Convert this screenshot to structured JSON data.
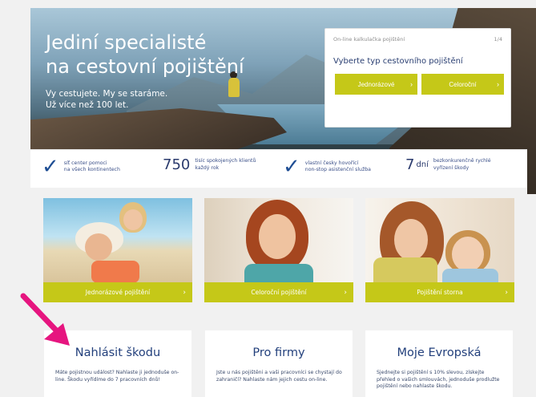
{
  "hero": {
    "title_line1": "Jediní specialisté",
    "title_line2": "na cestovní pojištění",
    "sub_line1": "Vy cestujete. My se staráme.",
    "sub_line2": "Už více než 100 let."
  },
  "quote": {
    "header_left": "On-line kalkulačka pojištění",
    "header_right": "1/4",
    "question": "Vyberte typ cestovního pojištění",
    "options": [
      "Jednorázové",
      "Celoroční"
    ]
  },
  "stats": [
    {
      "icon": "check-icon",
      "text_line1": "síť center pomoci",
      "text_line2": "na všech kontinentech"
    },
    {
      "number": "750",
      "text_line1": "tisíc spokojených klientů",
      "text_line2": "každý rok"
    },
    {
      "icon": "check-icon",
      "text_line1": "vlastní česky hovořící",
      "text_line2": "non-stop asistenční služba"
    },
    {
      "number": "7",
      "unit": "dní",
      "text_line1": "bezkonkurenčně rychlé",
      "text_line2": "vyřízení škody"
    }
  ],
  "products": [
    {
      "label": "Jednorázové pojištění"
    },
    {
      "label": "Celoroční pojištění"
    },
    {
      "label": "Pojištění storna"
    }
  ],
  "info_cards": [
    {
      "title": "Nahlásit škodu",
      "text": "Máte pojistnou událost? Nahlaste ji jednoduše on-line. Škodu vyřídíme do 7 pracovních dnů!"
    },
    {
      "title": "Pro firmy",
      "text": "Jste u nás pojištěni a vaši pracovníci se chystají do zahraničí? Nahlaste nám jejich cestu on-line."
    },
    {
      "title": "Moje Evropská",
      "text": "Sjednejte si pojištění s 10% slevou, získejte přehled o vašich smlouvách, jednoduše prodlužte pojištění nebo nahlaste škodu."
    }
  ],
  "colors": {
    "accent": "#c5c818",
    "brand": "#23407c",
    "highlight_arrow": "#e6157f"
  }
}
